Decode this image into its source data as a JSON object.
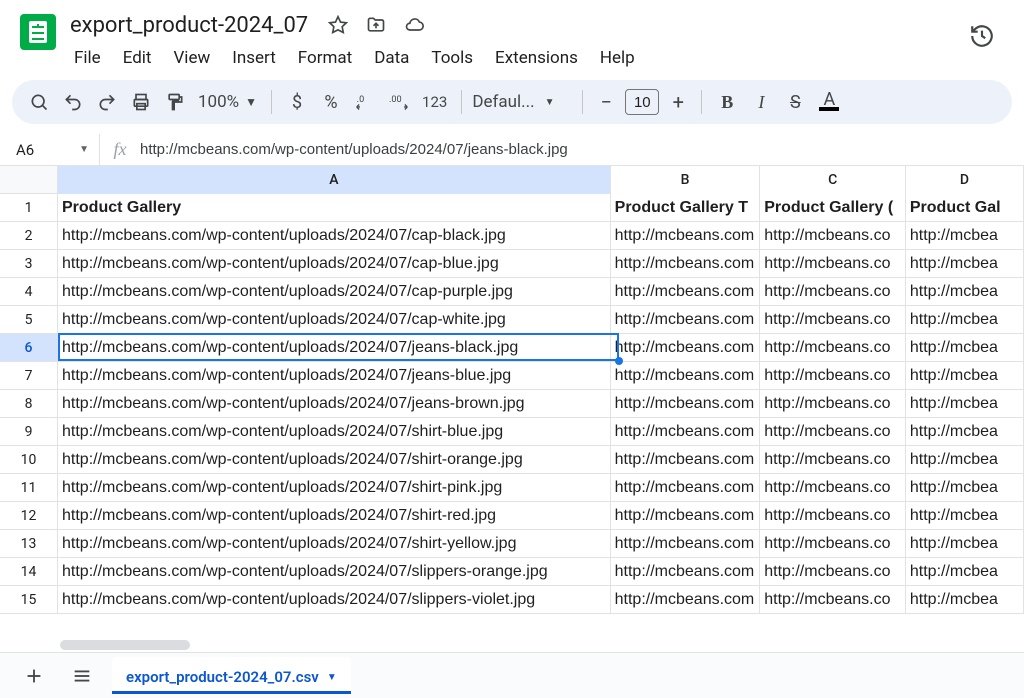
{
  "doc_title": "export_product-2024_07",
  "menubar": [
    "File",
    "Edit",
    "View",
    "Insert",
    "Format",
    "Data",
    "Tools",
    "Extensions",
    "Help"
  ],
  "toolbar": {
    "zoom": "100%",
    "font_name": "Defaul...",
    "font_size": "10",
    "number_hint": "123"
  },
  "name_box": "A6",
  "formula_bar": "http://mcbeans.com/wp-content/uploads/2024/07/jeans-black.jpg",
  "columns": [
    {
      "letter": "A",
      "width": "cw-A",
      "selected": true
    },
    {
      "letter": "B",
      "width": "cw-B",
      "selected": false
    },
    {
      "letter": "C",
      "width": "cw-C",
      "selected": false
    },
    {
      "letter": "D",
      "width": "cw-D",
      "selected": false
    }
  ],
  "selected_row": 6,
  "headers_row": {
    "A": "Product Gallery",
    "B": "Product Gallery T",
    "C": "Product Gallery (",
    "D": "Product Gal"
  },
  "other_col_trunc": {
    "B": "http://mcbeans.com",
    "C": "http://mcbeans.co",
    "D": "http://mcbea"
  },
  "rows": [
    "http://mcbeans.com/wp-content/uploads/2024/07/cap-black.jpg",
    "http://mcbeans.com/wp-content/uploads/2024/07/cap-blue.jpg",
    "http://mcbeans.com/wp-content/uploads/2024/07/cap-purple.jpg",
    "http://mcbeans.com/wp-content/uploads/2024/07/cap-white.jpg",
    "http://mcbeans.com/wp-content/uploads/2024/07/jeans-black.jpg",
    "http://mcbeans.com/wp-content/uploads/2024/07/jeans-blue.jpg",
    "http://mcbeans.com/wp-content/uploads/2024/07/jeans-brown.jpg",
    "http://mcbeans.com/wp-content/uploads/2024/07/shirt-blue.jpg",
    "http://mcbeans.com/wp-content/uploads/2024/07/shirt-orange.jpg",
    "http://mcbeans.com/wp-content/uploads/2024/07/shirt-pink.jpg",
    "http://mcbeans.com/wp-content/uploads/2024/07/shirt-red.jpg",
    "http://mcbeans.com/wp-content/uploads/2024/07/shirt-yellow.jpg",
    "http://mcbeans.com/wp-content/uploads/2024/07/slippers-orange.jpg",
    "http://mcbeans.com/wp-content/uploads/2024/07/slippers-violet.jpg"
  ],
  "sheet_tab": "export_product-2024_07.csv"
}
